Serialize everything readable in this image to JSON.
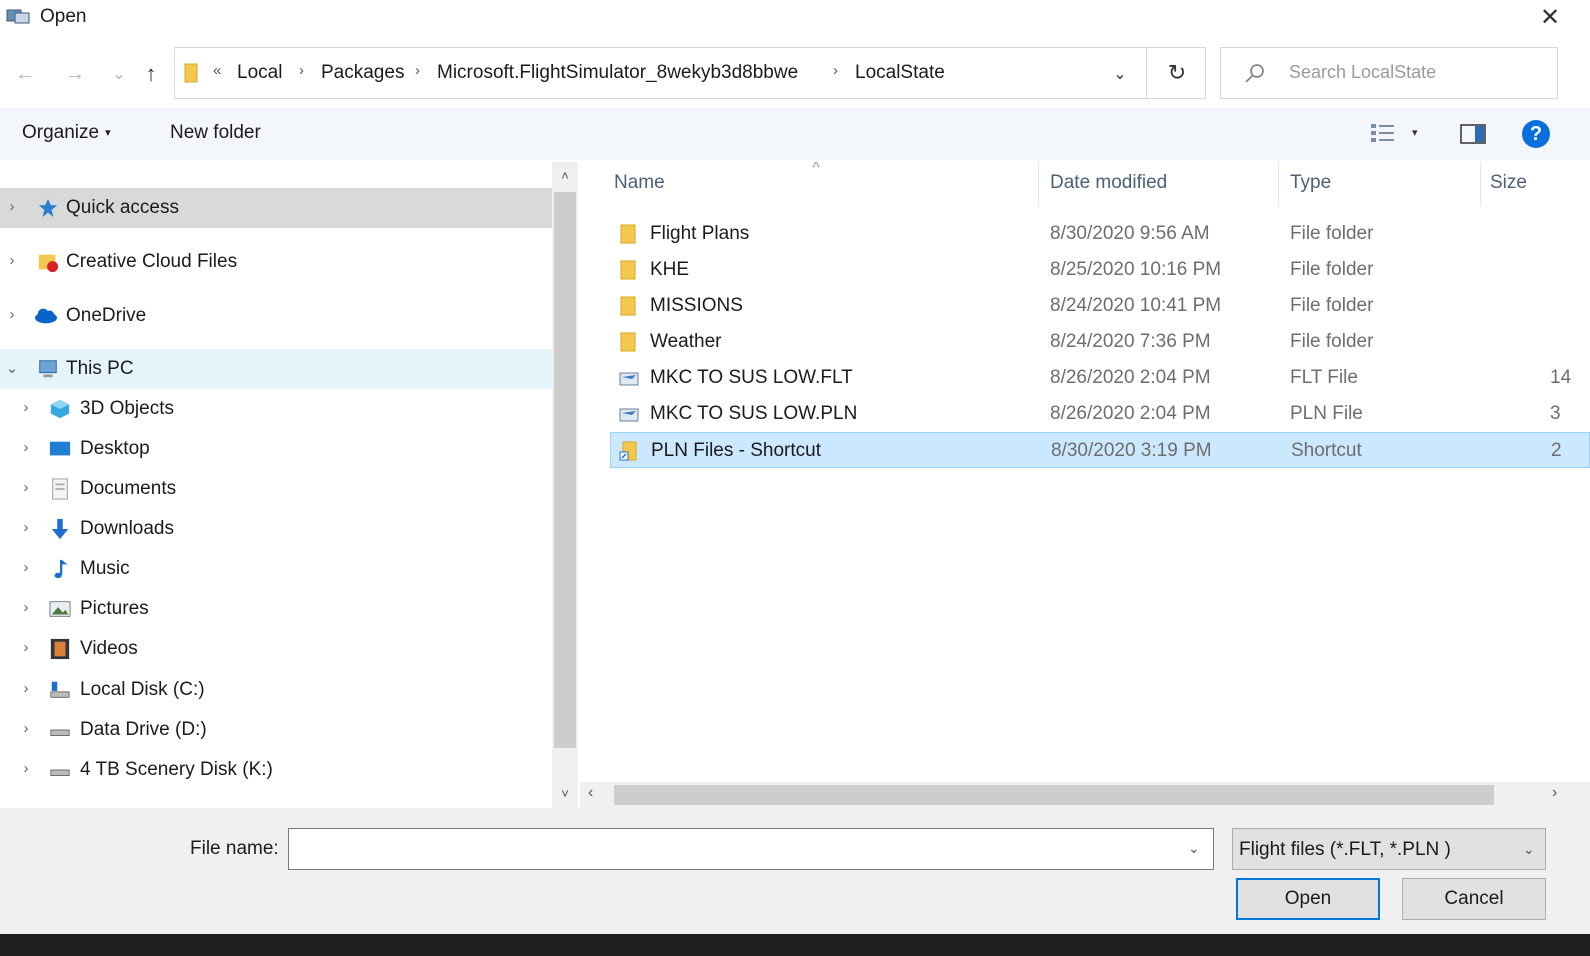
{
  "window": {
    "title": "Open",
    "close_glyph": "✕"
  },
  "nav_buttons": {
    "back": "←",
    "forward": "→",
    "recent": "⌄",
    "up": "↑"
  },
  "address": {
    "overflow": "«",
    "crumbs": [
      "Local",
      "Packages",
      "Microsoft.FlightSimulator_8wekyb3d8bbwe",
      "LocalState"
    ],
    "separator": "›",
    "dropdown_glyph": "⌄",
    "refresh_glyph": "↻"
  },
  "search": {
    "placeholder": "Search LocalState"
  },
  "toolbar": {
    "organize_label": "Organize",
    "organize_caret": "▾",
    "new_folder_label": "New folder",
    "view_caret": "▾",
    "help_glyph": "?"
  },
  "nav_pane": {
    "items": [
      {
        "label": "Quick access",
        "icon": "star-icon",
        "chevron": "›"
      },
      {
        "label": "Creative Cloud Files",
        "icon": "creative-cloud-folder-icon",
        "chevron": "›"
      },
      {
        "label": "OneDrive",
        "icon": "cloud-icon",
        "chevron": "›"
      },
      {
        "label": "This PC",
        "icon": "computer-icon",
        "chevron": "⌄"
      },
      {
        "label": "3D Objects",
        "icon": "cube-icon",
        "chevron": "›"
      },
      {
        "label": "Desktop",
        "icon": "desktop-icon",
        "chevron": "›"
      },
      {
        "label": "Documents",
        "icon": "document-icon",
        "chevron": "›"
      },
      {
        "label": "Downloads",
        "icon": "download-arrow-icon",
        "chevron": "›"
      },
      {
        "label": "Music",
        "icon": "music-note-icon",
        "chevron": "›"
      },
      {
        "label": "Pictures",
        "icon": "picture-icon",
        "chevron": "›"
      },
      {
        "label": "Videos",
        "icon": "film-icon",
        "chevron": "›"
      },
      {
        "label": "Local Disk (C:)",
        "icon": "drive-c-icon",
        "chevron": "›"
      },
      {
        "label": "Data Drive (D:)",
        "icon": "drive-icon",
        "chevron": "›"
      },
      {
        "label": "4 TB Scenery Disk (K:)",
        "icon": "drive-icon",
        "chevron": "›"
      }
    ],
    "scroll_up": "˄",
    "scroll_down": "˅"
  },
  "file_list": {
    "sort_glyph": "˄",
    "columns": {
      "name": "Name",
      "date": "Date modified",
      "type": "Type",
      "size": "Size"
    },
    "rows": [
      {
        "name": "Flight Plans",
        "date": "8/30/2020 9:56 AM",
        "type": "File folder",
        "size": "",
        "icon": "folder-icon"
      },
      {
        "name": "KHE",
        "date": "8/25/2020 10:16 PM",
        "type": "File folder",
        "size": "",
        "icon": "folder-icon"
      },
      {
        "name": "MISSIONS",
        "date": "8/24/2020 10:41 PM",
        "type": "File folder",
        "size": "",
        "icon": "folder-icon"
      },
      {
        "name": "Weather",
        "date": "8/24/2020 7:36 PM",
        "type": "File folder",
        "size": "",
        "icon": "folder-icon"
      },
      {
        "name": "MKC TO SUS LOW.FLT",
        "date": "8/26/2020 2:04 PM",
        "type": "FLT File",
        "size": "14",
        "icon": "flight-file-icon"
      },
      {
        "name": "MKC TO SUS LOW.PLN",
        "date": "8/26/2020 2:04 PM",
        "type": "PLN File",
        "size": "3",
        "icon": "flight-file-icon"
      },
      {
        "name": "PLN Files - Shortcut",
        "date": "8/30/2020 3:19 PM",
        "type": "Shortcut",
        "size": "2",
        "icon": "shortcut-icon"
      }
    ],
    "hscroll_left": "‹",
    "hscroll_right": "›"
  },
  "footer": {
    "file_name_label": "File name:",
    "file_name_value": "",
    "file_name_caret": "⌄",
    "filter_value": "Flight files (*.FLT, *.PLN )",
    "filter_caret": "⌄",
    "open_label": "Open",
    "cancel_label": "Cancel"
  },
  "colors": {
    "selection": "#cce8ff",
    "selection_border": "#99d1ff",
    "nav_selected": "#d9d9d9",
    "this_pc_highlight": "#e5f3fb",
    "header_text": "#4c607a",
    "help_blue": "#0a6fdc",
    "folder_yellow": "#f2c94c"
  }
}
